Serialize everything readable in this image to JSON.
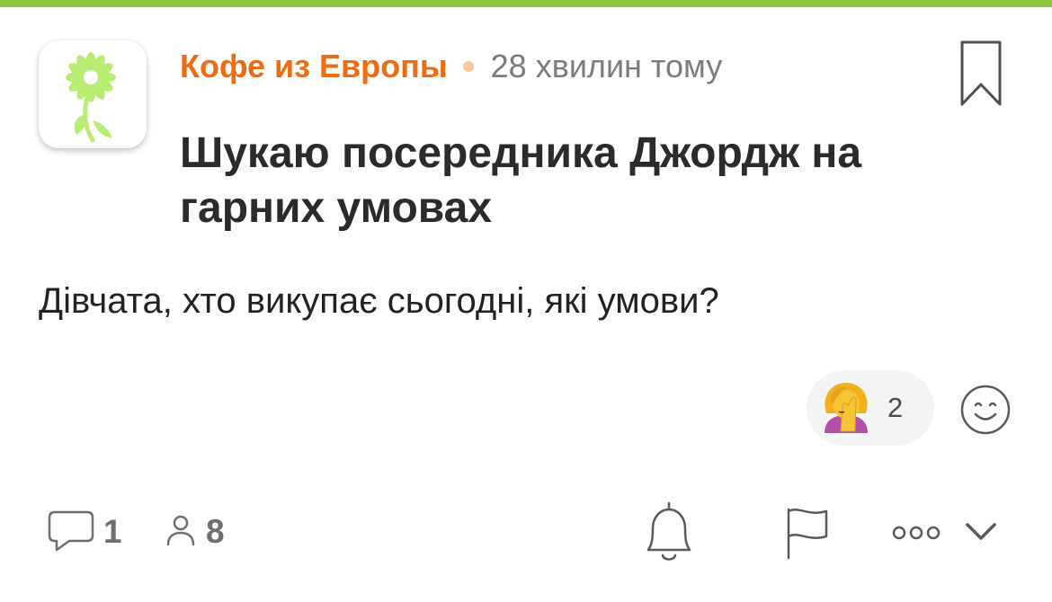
{
  "post": {
    "author": "Кофе из Европы",
    "time": "28 хвилин тому",
    "title": "Шукаю посередника Джордж на гарних умовах",
    "body": "Дівчата, хто викупає сьогодні, які умови?"
  },
  "reaction": {
    "emoji": "face-palm-woman",
    "count": "2"
  },
  "footer": {
    "comments_count": "1",
    "participants_count": "8"
  },
  "colors": {
    "accent_green": "#8dc63f",
    "author_orange": "#f06b0f",
    "logo_green": "#b5eb6f"
  },
  "icons": [
    "flower-logo-icon",
    "bookmark-icon",
    "face-palm-emoji-icon",
    "add-reaction-smile-icon",
    "comment-icon",
    "person-icon",
    "bell-icon",
    "flag-icon",
    "more-icon",
    "chevron-down-icon"
  ]
}
